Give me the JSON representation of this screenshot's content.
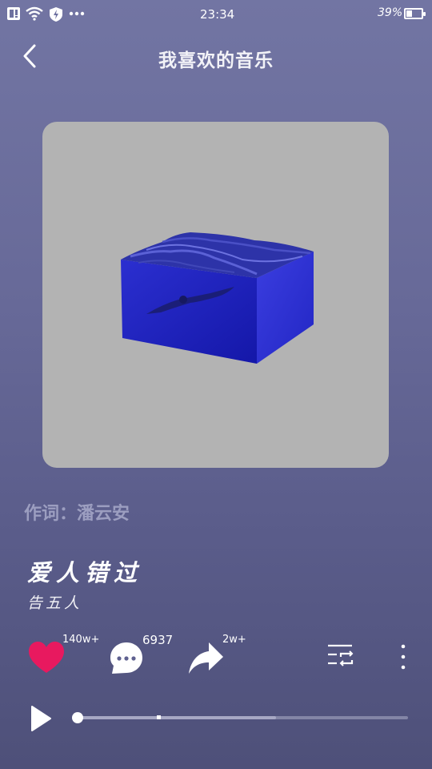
{
  "status_bar": {
    "time": "23:34",
    "battery_percent": "39%",
    "battery_level": 0.39
  },
  "header": {
    "title": "我喜欢的音乐",
    "back_icon": "chevron-left-icon"
  },
  "artwork": {
    "description_icon": "album-cover-ocean-block"
  },
  "lyricist": {
    "label": "作词：潘云安"
  },
  "song": {
    "title": "爱人错过",
    "artist": "告五人"
  },
  "actions": {
    "like_count": "140w+",
    "comment_count": "6937",
    "share_count": "2w+",
    "like_color": "#e8195f"
  },
  "player": {
    "progress": 0.0,
    "buffered": 0.6
  }
}
